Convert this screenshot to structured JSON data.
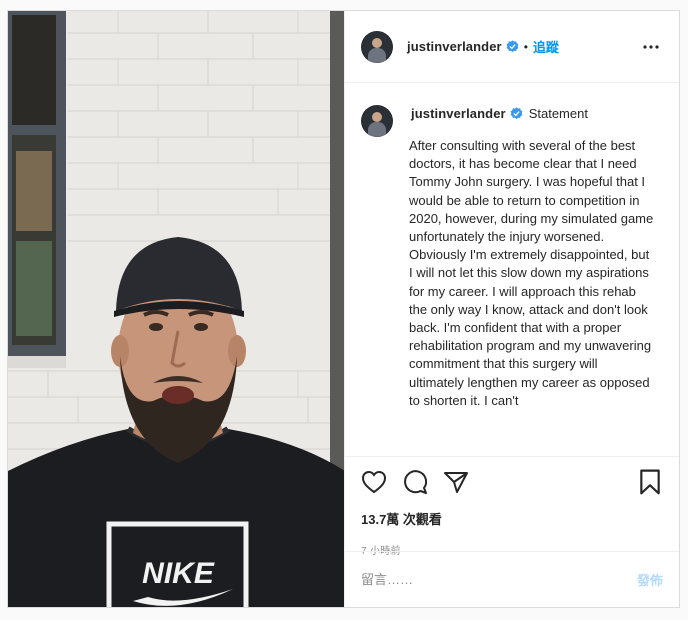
{
  "post": {
    "username": "justinverlander",
    "follow_label": "追蹤",
    "separator": "•"
  },
  "caption": {
    "username": "justinverlander",
    "title": "Statement",
    "text": "After consulting with several of the best doctors, it has become clear that I need Tommy John surgery. I was hopeful that I would be able to return to competition in 2020, however, during my simulated game unfortunately the injury worsened. Obviously I'm extremely disappointed, but I will not let this slow down my aspirations for my career. I will approach this rehab the only way I know, attack and don't look back. I'm confident that with a proper rehabilitation program and my unwavering commitment that this surgery will ultimately lengthen my career as opposed to shorten it. I can't"
  },
  "actions": {
    "views": "13.7萬 次觀看",
    "time": "7 小時前"
  },
  "comment": {
    "placeholder": "留言……",
    "post_label": "發佈"
  },
  "media": {
    "shirt_logo_text": "NIKE"
  },
  "colors": {
    "link_blue": "#0095f6",
    "verified_blue": "#3897f0",
    "post_disabled": "#b3dbff",
    "border": "#dbdbdb"
  },
  "icons": [
    "verified-badge-icon",
    "more-options-icon",
    "heart-icon",
    "comment-icon",
    "share-icon",
    "bookmark-icon"
  ]
}
